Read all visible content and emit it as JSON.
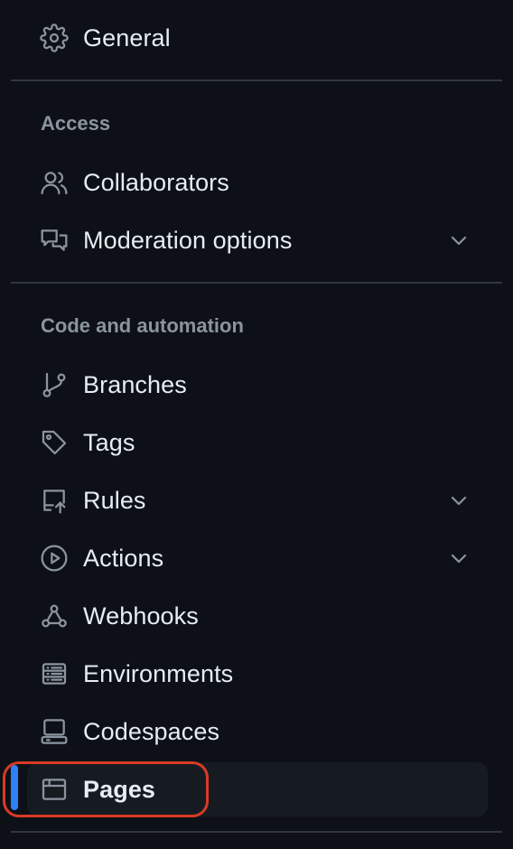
{
  "sidebar": {
    "general": {
      "label": "General",
      "icon": "gear-icon"
    },
    "sections": {
      "access": "Access",
      "code_automation": "Code and automation"
    },
    "access_items": [
      {
        "label": "Collaborators",
        "icon": "people-icon"
      },
      {
        "label": "Moderation options",
        "icon": "comment-discussion-icon",
        "expandable": true
      }
    ],
    "code_items": [
      {
        "label": "Branches",
        "icon": "git-branch-icon"
      },
      {
        "label": "Tags",
        "icon": "tag-icon"
      },
      {
        "label": "Rules",
        "icon": "repo-push-icon",
        "expandable": true
      },
      {
        "label": "Actions",
        "icon": "play-icon",
        "expandable": true
      },
      {
        "label": "Webhooks",
        "icon": "webhook-icon"
      },
      {
        "label": "Environments",
        "icon": "server-icon"
      },
      {
        "label": "Codespaces",
        "icon": "codespaces-icon"
      },
      {
        "label": "Pages",
        "icon": "browser-icon",
        "active": true
      }
    ],
    "colors": {
      "background": "#0d1117",
      "active_bg": "#161b22",
      "active_indicator": "#2f81f7",
      "highlight_ring": "#d93a26",
      "muted": "#8b949e",
      "text": "#e6edf3"
    }
  }
}
